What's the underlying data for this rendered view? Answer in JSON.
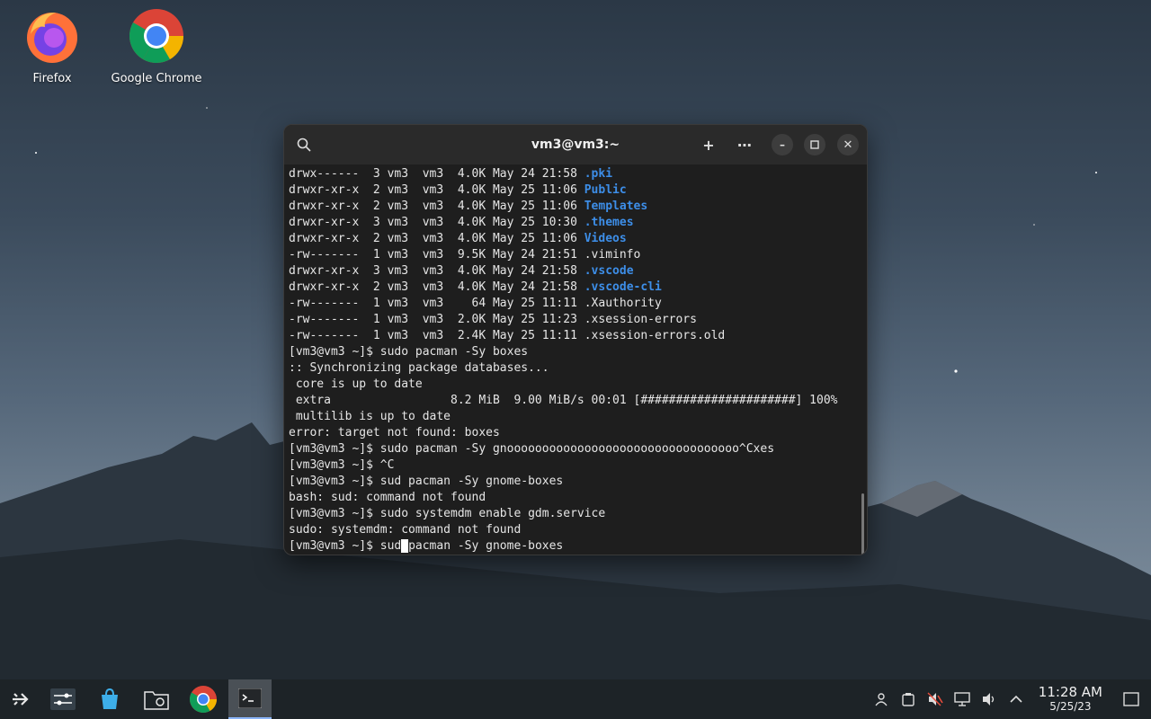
{
  "desktop": {
    "icons": [
      {
        "label": "Firefox",
        "icon": "firefox-icon"
      },
      {
        "label": "Google Chrome",
        "icon": "chrome-icon"
      }
    ]
  },
  "terminal": {
    "title": "vm3@vm3:~",
    "lines": [
      [
        {
          "t": "drwx------  3 vm3  vm3  4.0K May 24 21:58 "
        },
        {
          "t": ".pki",
          "c": "dir"
        }
      ],
      [
        {
          "t": "drwxr-xr-x  2 vm3  vm3  4.0K May 25 11:06 "
        },
        {
          "t": "Public",
          "c": "dir"
        }
      ],
      [
        {
          "t": "drwxr-xr-x  2 vm3  vm3  4.0K May 25 11:06 "
        },
        {
          "t": "Templates",
          "c": "dir"
        }
      ],
      [
        {
          "t": "drwxr-xr-x  3 vm3  vm3  4.0K May 25 10:30 "
        },
        {
          "t": ".themes",
          "c": "dir"
        }
      ],
      [
        {
          "t": "drwxr-xr-x  2 vm3  vm3  4.0K May 25 11:06 "
        },
        {
          "t": "Videos",
          "c": "dir"
        }
      ],
      [
        {
          "t": "-rw-------  1 vm3  vm3  9.5K May 24 21:51 .viminfo"
        }
      ],
      [
        {
          "t": "drwxr-xr-x  3 vm3  vm3  4.0K May 24 21:58 "
        },
        {
          "t": ".vscode",
          "c": "dir"
        }
      ],
      [
        {
          "t": "drwxr-xr-x  2 vm3  vm3  4.0K May 24 21:58 "
        },
        {
          "t": ".vscode-cli",
          "c": "dir"
        }
      ],
      [
        {
          "t": "-rw-------  1 vm3  vm3    64 May 25 11:11 .Xauthority"
        }
      ],
      [
        {
          "t": "-rw-------  1 vm3  vm3  2.0K May 25 11:23 .xsession-errors"
        }
      ],
      [
        {
          "t": "-rw-------  1 vm3  vm3  2.4K May 25 11:11 .xsession-errors.old"
        }
      ],
      [
        {
          "t": "[vm3@vm3 ~]$ sudo pacman -Sy boxes"
        }
      ],
      [
        {
          "t": ":: Synchronizing package databases..."
        }
      ],
      [
        {
          "t": " core is up to date"
        }
      ],
      [
        {
          "t": " extra                 8.2 MiB  9.00 MiB/s 00:01 [######################] 100%"
        }
      ],
      [
        {
          "t": " multilib is up to date"
        }
      ],
      [
        {
          "t": "error: target not found: boxes"
        }
      ],
      [
        {
          "t": "[vm3@vm3 ~]$ sudo pacman -Sy gnooooooooooooooooooooooooooooooooo^Cxes"
        }
      ],
      [
        {
          "t": "[vm3@vm3 ~]$ ^C"
        }
      ],
      [
        {
          "t": "[vm3@vm3 ~]$ sud pacman -Sy gnome-boxes"
        }
      ],
      [
        {
          "t": "bash: sud: command not found"
        }
      ],
      [
        {
          "t": "[vm3@vm3 ~]$ sudo systemdm enable gdm.service"
        }
      ],
      [
        {
          "t": "sudo: systemdm: command not found"
        }
      ],
      [
        {
          "t": "[vm3@vm3 ~]$ sud"
        },
        {
          "t": " ",
          "c": "cursor"
        },
        {
          "t": "pacman -Sy gnome-boxes"
        }
      ]
    ]
  },
  "taskbar": {
    "items": [
      {
        "name": "app-launcher-icon"
      },
      {
        "name": "settings-sliders-icon"
      },
      {
        "name": "software-store-icon"
      },
      {
        "name": "file-manager-icon"
      },
      {
        "name": "chrome-icon"
      },
      {
        "name": "terminal-icon",
        "active": true
      }
    ],
    "tray": [
      "user-icon",
      "clipboard-icon",
      "mute-icon",
      "network-icon",
      "volume-icon",
      "chevron-up-icon"
    ],
    "clock": {
      "time": "11:28 AM",
      "date": "5/25/23"
    }
  }
}
